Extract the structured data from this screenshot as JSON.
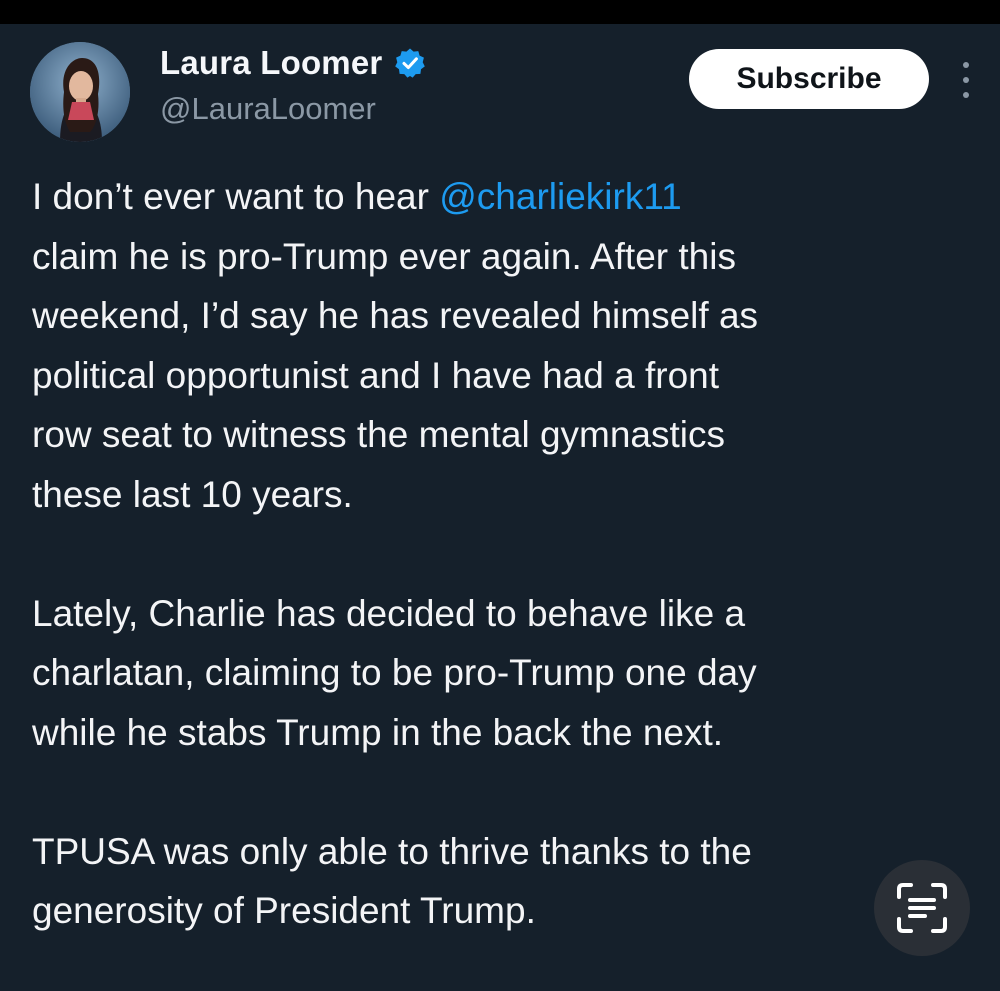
{
  "author": {
    "display_name": "Laura Loomer",
    "handle": "@LauraLoomer",
    "verified": true
  },
  "actions": {
    "subscribe_label": "Subscribe"
  },
  "tweet": {
    "p1": {
      "l1_text": "I don’t ever want to hear ",
      "mention": "@charliekirk11",
      "l2": "claim he is pro-Trump ever again. After this",
      "l3": "weekend, I’d say he has revealed himself as",
      "l4": "political opportunist and I have had a front",
      "l5": "row seat to witness the mental gymnastics",
      "l6": "these last 10 years."
    },
    "p2": {
      "l1": "Lately, Charlie has decided to behave like a",
      "l2": "charlatan, claiming to be pro-Trump one day",
      "l3": "while he stabs Trump in the back the next."
    },
    "p3": {
      "l1": "TPUSA was only able to thrive thanks to the",
      "l2": "generosity of President Trump."
    }
  },
  "icons": {
    "verified": "verified-badge-icon",
    "more": "more-options-icon",
    "scan": "scan-text-icon"
  },
  "colors": {
    "background": "#15202b",
    "accent": "#1d9bf0",
    "secondary_text": "#8b98a5"
  }
}
